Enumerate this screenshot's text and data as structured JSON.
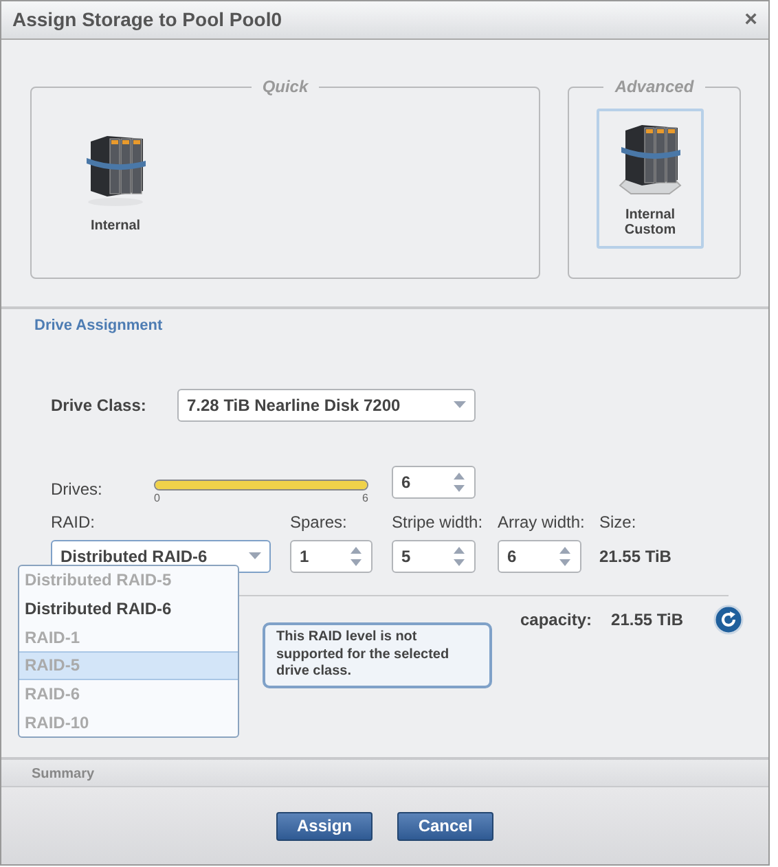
{
  "window": {
    "title": "Assign Storage to Pool Pool0",
    "close": "×"
  },
  "storage_groups": [
    {
      "title": "Quick",
      "options": [
        {
          "label": "Internal",
          "kind": "plain",
          "selected": false
        }
      ]
    },
    {
      "title": "Advanced",
      "options": [
        {
          "label": "Internal Custom",
          "kind": "custom",
          "selected": true
        }
      ]
    }
  ],
  "drive_assignment": {
    "title": "Drive Assignment",
    "drive_class": {
      "label": "Drive Class:",
      "value": "7.28 TiB Nearline Disk 7200"
    },
    "drives": {
      "label": "Drives:",
      "level": 1,
      "min": "0",
      "max": "6",
      "value": "6"
    },
    "raid": {
      "label": "RAID:",
      "value": "Distributed RAID-6",
      "options": [
        {
          "label": "Distributed RAID-5",
          "disabled": true,
          "highlighted": false
        },
        {
          "label": "Distributed RAID-6",
          "disabled": false,
          "highlighted": false
        },
        {
          "label": "RAID-1",
          "disabled": true,
          "highlighted": false
        },
        {
          "label": "RAID-5",
          "disabled": true,
          "highlighted": true
        },
        {
          "label": "RAID-6",
          "disabled": true,
          "highlighted": false
        },
        {
          "label": "RAID-10",
          "disabled": true,
          "highlighted": false
        }
      ]
    },
    "spares": {
      "label": "Spares:",
      "value": "1"
    },
    "stripe_width": {
      "label": "Stripe width:",
      "value": "5"
    },
    "array_width": {
      "label": "Array width:",
      "value": "6"
    },
    "size": {
      "label": "Size:",
      "value": "21.55 TiB"
    },
    "capacity": {
      "label": "capacity:",
      "value": "21.55 TiB"
    },
    "tooltip": "This RAID level is not supported for the selected drive class."
  },
  "summary": {
    "title": "Summary"
  },
  "buttons": [
    "Assign",
    "Cancel"
  ]
}
